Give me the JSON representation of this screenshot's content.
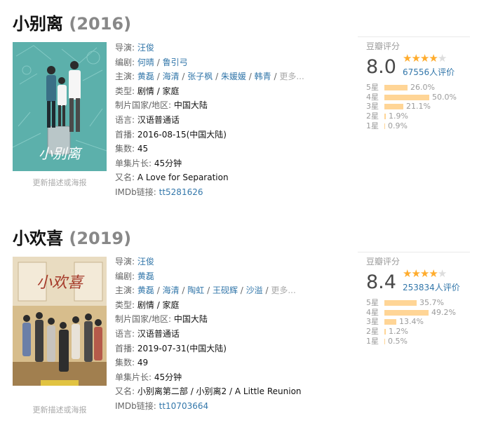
{
  "entries": [
    {
      "title": "小别离",
      "year": "(2016)",
      "poster_edit": "更新描述或海报",
      "director_label": "导演:",
      "directors": [
        "汪俊"
      ],
      "writer_label": "编剧:",
      "writers": [
        "何晴",
        "鲁引弓"
      ],
      "cast_label": "主演:",
      "cast": [
        "黄磊",
        "海清",
        "张子枫",
        "朱媛媛",
        "韩青"
      ],
      "more": "更多...",
      "genre_label": "类型:",
      "genre": "剧情 / 家庭",
      "country_label": "制片国家/地区:",
      "country": "中国大陆",
      "language_label": "语言:",
      "language": "汉语普通话",
      "premiere_label": "首播:",
      "premiere": "2016-08-15(中国大陆)",
      "episodes_label": "集数:",
      "episodes": "45",
      "runtime_label": "单集片长:",
      "runtime": "45分钟",
      "aka_label": "又名:",
      "aka": "A Love for Separation",
      "imdb_label": "IMDb链接:",
      "imdb": "tt5281626",
      "rating": {
        "label": "豆瓣评分",
        "score": "8.0",
        "stars_filled": 4,
        "votes": "67556人评价",
        "dist": [
          {
            "k": "5星",
            "pct": "26.0%",
            "value": 26.0
          },
          {
            "k": "4星",
            "pct": "50.0%",
            "value": 50.0
          },
          {
            "k": "3星",
            "pct": "21.1%",
            "value": 21.1
          },
          {
            "k": "2星",
            "pct": "1.9%",
            "value": 1.9
          },
          {
            "k": "1星",
            "pct": "0.9%",
            "value": 0.9
          }
        ]
      },
      "poster_text": "小别离",
      "poster_colors": {
        "bg": "#4fa8a3",
        "accent": "#2f7f86"
      }
    },
    {
      "title": "小欢喜",
      "year": "(2019)",
      "poster_edit": "更新描述或海报",
      "director_label": "导演:",
      "directors": [
        "汪俊"
      ],
      "writer_label": "编剧:",
      "writers": [
        "黄磊"
      ],
      "cast_label": "主演:",
      "cast": [
        "黄磊",
        "海清",
        "陶虹",
        "王砚辉",
        "沙溢"
      ],
      "more": "更多...",
      "genre_label": "类型:",
      "genre": "剧情 / 家庭",
      "country_label": "制片国家/地区:",
      "country": "中国大陆",
      "language_label": "语言:",
      "language": "汉语普通话",
      "premiere_label": "首播:",
      "premiere": "2019-07-31(中国大陆)",
      "episodes_label": "集数:",
      "episodes": "49",
      "runtime_label": "单集片长:",
      "runtime": "45分钟",
      "aka_label": "又名:",
      "aka": "小别离第二部 / 小别离2 / A Little Reunion",
      "imdb_label": "IMDb链接:",
      "imdb": "tt10703664",
      "rating": {
        "label": "豆瓣评分",
        "score": "8.4",
        "stars_filled": 4,
        "votes": "253834人评价",
        "dist": [
          {
            "k": "5星",
            "pct": "35.7%",
            "value": 35.7
          },
          {
            "k": "4星",
            "pct": "49.2%",
            "value": 49.2
          },
          {
            "k": "3星",
            "pct": "13.4%",
            "value": 13.4
          },
          {
            "k": "2星",
            "pct": "1.2%",
            "value": 1.2
          },
          {
            "k": "1星",
            "pct": "0.5%",
            "value": 0.5
          }
        ]
      },
      "poster_text": "小欢喜",
      "poster_colors": {
        "bg": "#c9a66b",
        "accent": "#8a6a3d"
      }
    }
  ],
  "colors": {
    "link": "#3377aa",
    "star": "#ffac2d",
    "bar": "#ffd596"
  }
}
